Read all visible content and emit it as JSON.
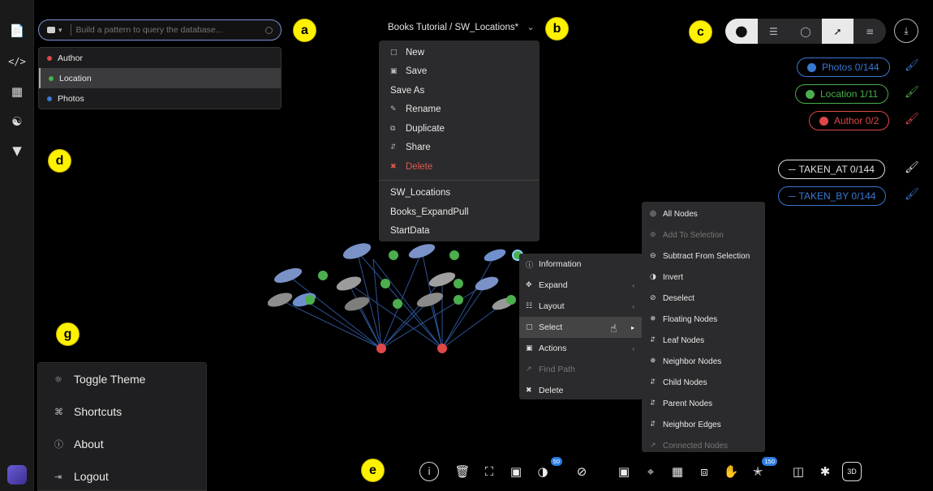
{
  "rail": {
    "icons": [
      "file-icon",
      "code-icon",
      "table-icon",
      "hierarchy-icon",
      "filter-icon",
      "app-logo"
    ]
  },
  "query": {
    "placeholder": "Build a pattern to query the database..."
  },
  "labels": [
    {
      "name": "Author",
      "color": "#e04848"
    },
    {
      "name": "Location",
      "color": "#4cae4c"
    },
    {
      "name": "Photos",
      "color": "#3a78d2"
    }
  ],
  "callouts": [
    "a",
    "b",
    "c",
    "d",
    "e",
    "g"
  ],
  "header": {
    "title": "Books Tutorial / SW_Locations*",
    "chevron": "⌄"
  },
  "file_menu": {
    "items": [
      {
        "label": "New",
        "icon": "□"
      },
      {
        "label": "Save",
        "icon": "▣"
      },
      {
        "label": "Save As",
        "icon": ""
      },
      {
        "label": "Rename",
        "icon": "✎"
      },
      {
        "label": "Duplicate",
        "icon": "⧉"
      },
      {
        "label": "Share",
        "icon": "⮃"
      },
      {
        "label": "Delete",
        "icon": "✖"
      }
    ],
    "recent": [
      "SW_Locations",
      "Books_ExpandPull",
      "StartData"
    ]
  },
  "legend": {
    "nodes": [
      {
        "label": "Photos 0/144",
        "color": "#3a78d2"
      },
      {
        "label": "Location 1/11",
        "color": "#4cae4c"
      },
      {
        "label": "Author 0/2",
        "color": "#e04848"
      }
    ],
    "edges": [
      {
        "label": "TAKEN_AT 0/144",
        "color": "#e0e0e0"
      },
      {
        "label": "TAKEN_BY 0/144",
        "color": "#3a78d2"
      }
    ]
  },
  "context_menu": [
    {
      "label": "Information",
      "icon": "ⓘ",
      "arrow": ""
    },
    {
      "label": "Expand",
      "icon": "✥",
      "arrow": "‹"
    },
    {
      "label": "Layout",
      "icon": "☷",
      "arrow": "‹"
    },
    {
      "label": "Select",
      "icon": "▢",
      "arrow": "▸"
    },
    {
      "label": "Actions",
      "icon": "▣",
      "arrow": "‹"
    },
    {
      "label": "Find Path",
      "icon": "↗",
      "arrow": ""
    },
    {
      "label": "Delete",
      "icon": "✖",
      "arrow": ""
    }
  ],
  "select_submenu": [
    {
      "label": "All Nodes",
      "icon": "◎"
    },
    {
      "label": "Add To Selection",
      "icon": "⊕"
    },
    {
      "label": "Subtract From Selection",
      "icon": "⊖"
    },
    {
      "label": "Invert",
      "icon": "◑"
    },
    {
      "label": "Deselect",
      "icon": "⊘"
    },
    {
      "label": "Floating Nodes",
      "icon": "✵"
    },
    {
      "label": "Leaf Nodes",
      "icon": "⮃"
    },
    {
      "label": "Neighbor Nodes",
      "icon": "✵"
    },
    {
      "label": "Child Nodes",
      "icon": "⮃"
    },
    {
      "label": "Parent Nodes",
      "icon": "⮃"
    },
    {
      "label": "Neighbor Edges",
      "icon": "⮃"
    },
    {
      "label": "Connected Nodes",
      "icon": "↗"
    }
  ],
  "bottom_menu": [
    {
      "label": "Toggle Theme",
      "icon": "☼"
    },
    {
      "label": "Shortcuts",
      "icon": "⌘"
    },
    {
      "label": "About",
      "icon": "ⓘ"
    },
    {
      "label": "Logout",
      "icon": "⇥"
    }
  ],
  "toolbar": {
    "badge_a": "50",
    "badge_b": "150",
    "label_3d": "3D"
  },
  "colors": {
    "accent_blue": "#3a78d2",
    "green": "#4cae4c",
    "red": "#e04848",
    "callout": "#fff200"
  }
}
